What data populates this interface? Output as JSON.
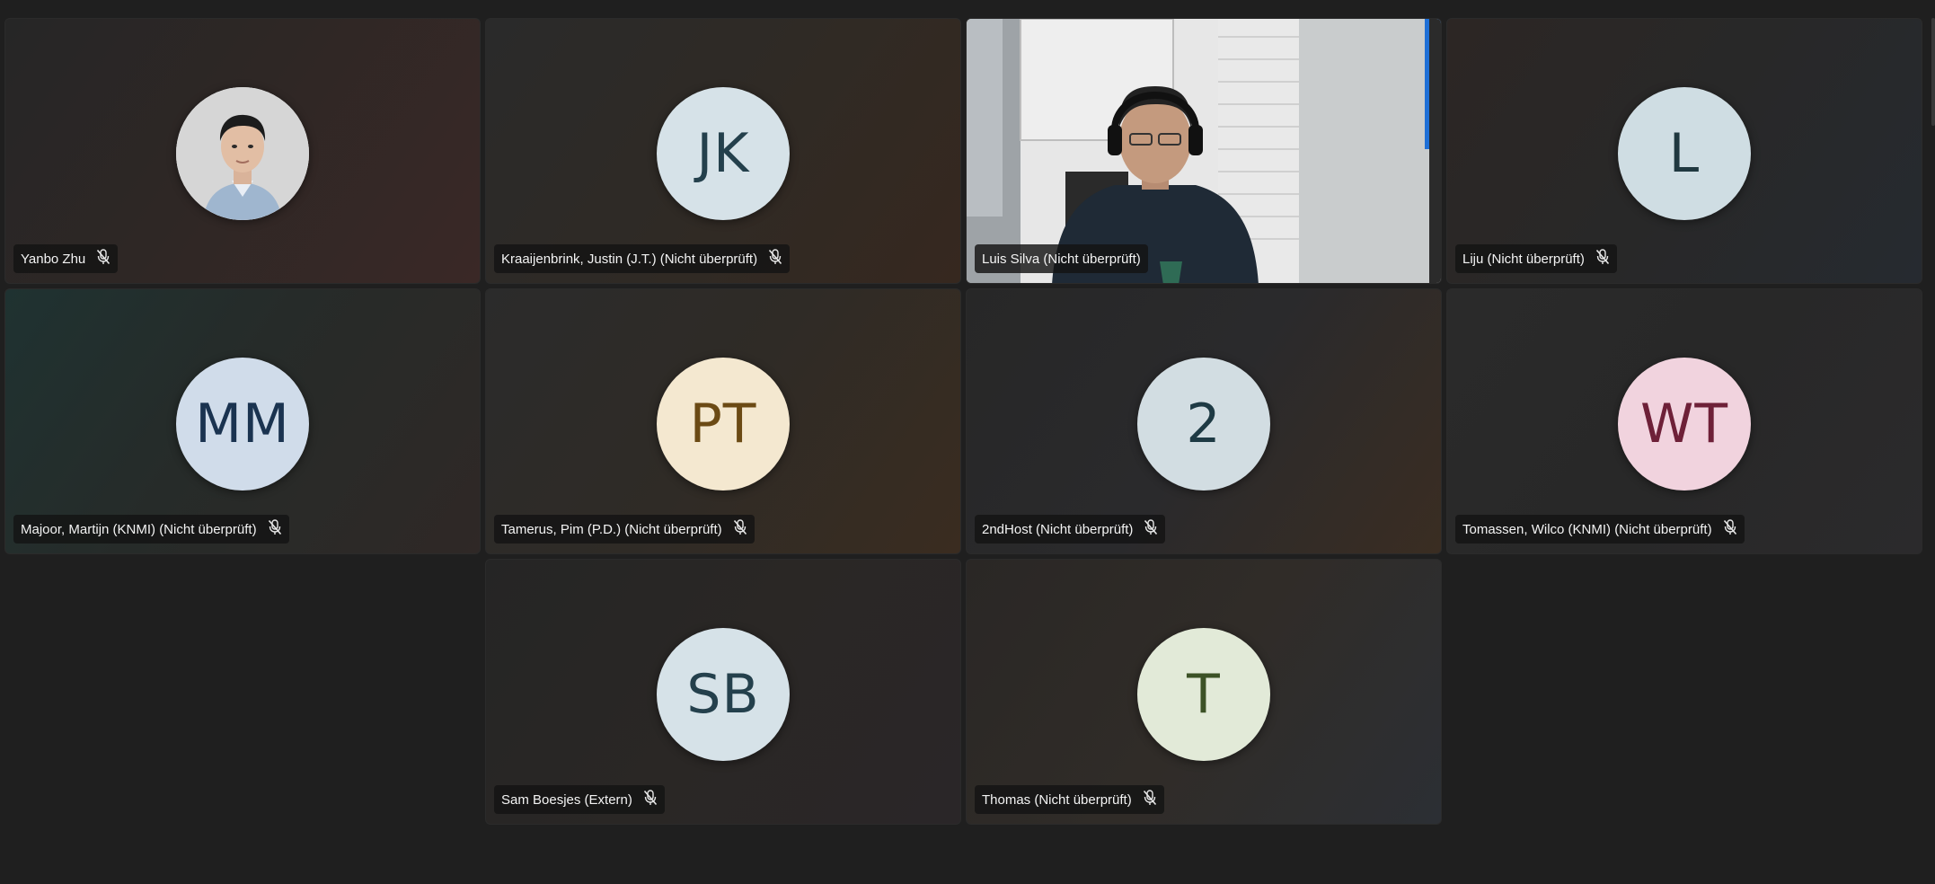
{
  "participants": [
    {
      "name": "Yanbo Zhu",
      "initials": "",
      "avatar_kind": "photo",
      "muted": true,
      "avatar_bg": "#c8c8c8",
      "initials_color": "#1f3a4a",
      "tile_bg": "linear-gradient(125deg,#262626 0%,#2e2725 45%,#3a2826 100%)"
    },
    {
      "name": "Kraaijenbrink, Justin (J.T.) (Nicht überprüft)",
      "initials": "JK",
      "avatar_kind": "initials",
      "muted": true,
      "avatar_bg": "#d6e2e8",
      "initials_color": "#24404c",
      "tile_bg": "linear-gradient(125deg,#2a2a2a 0%,#2f2a25 50%,#36281f 100%)"
    },
    {
      "name": "Luis Silva (Nicht überprüft)",
      "initials": "",
      "avatar_kind": "video",
      "muted": false,
      "avatar_bg": "",
      "initials_color": "",
      "tile_bg": "#d8d8d8"
    },
    {
      "name": "Liju (Nicht überprüft)",
      "initials": "L",
      "avatar_kind": "initials",
      "muted": true,
      "avatar_bg": "#cfdde3",
      "initials_color": "#203840",
      "tile_bg": "linear-gradient(125deg,#2c2624 0%,#282828 50%,#262a30 100%)"
    },
    {
      "name": "Majoor, Martijn (KNMI) (Nicht überprüft)",
      "initials": "MM",
      "avatar_kind": "initials",
      "muted": true,
      "avatar_bg": "#d0dcea",
      "initials_color": "#1a3350",
      "tile_bg": "linear-gradient(125deg,#1f3231 0%,#262b29 45%,#2f2826 100%)"
    },
    {
      "name": "Tamerus, Pim (P.D.) (Nicht überprüft)",
      "initials": "PT",
      "avatar_kind": "initials",
      "muted": true,
      "avatar_bg": "#f4e8d0",
      "initials_color": "#6b4a14",
      "tile_bg": "linear-gradient(125deg,#2b2b2b 0%,#2f2b26 50%,#3a2c20 100%)"
    },
    {
      "name": "2ndHost (Nicht überprüft)",
      "initials": "2",
      "avatar_kind": "initials",
      "muted": true,
      "avatar_bg": "#d2dde2",
      "initials_color": "#1e3a44",
      "tile_bg": "linear-gradient(125deg,#272727 0%,#2a2a2c 50%,#3a2d22 100%)"
    },
    {
      "name": "Tomassen, Wilco (KNMI) (Nicht überprüft)",
      "initials": "WT",
      "avatar_kind": "initials",
      "muted": true,
      "avatar_bg": "#f1d3de",
      "initials_color": "#6e2038",
      "tile_bg": "linear-gradient(125deg,#2a2a2a 0%,#282828 50%,#2b2a2c 100%)"
    },
    {
      "name": "Sam Boesjes (Extern)",
      "initials": "SB",
      "avatar_kind": "initials",
      "muted": true,
      "avatar_bg": "#d6e2e8",
      "initials_color": "#24404c",
      "tile_bg": "linear-gradient(125deg,#252525 0%,#2a2725 50%,#2a2628 100%)"
    },
    {
      "name": "Thomas (Nicht überprüft)",
      "initials": "T",
      "avatar_kind": "initials",
      "muted": true,
      "avatar_bg": "#e2ead8",
      "initials_color": "#3c5226",
      "tile_bg": "linear-gradient(125deg,#2a2725 0%,#302c28 50%,#2c2f34 100%)"
    }
  ],
  "icons": {
    "mic_muted": "mic-off-icon"
  }
}
